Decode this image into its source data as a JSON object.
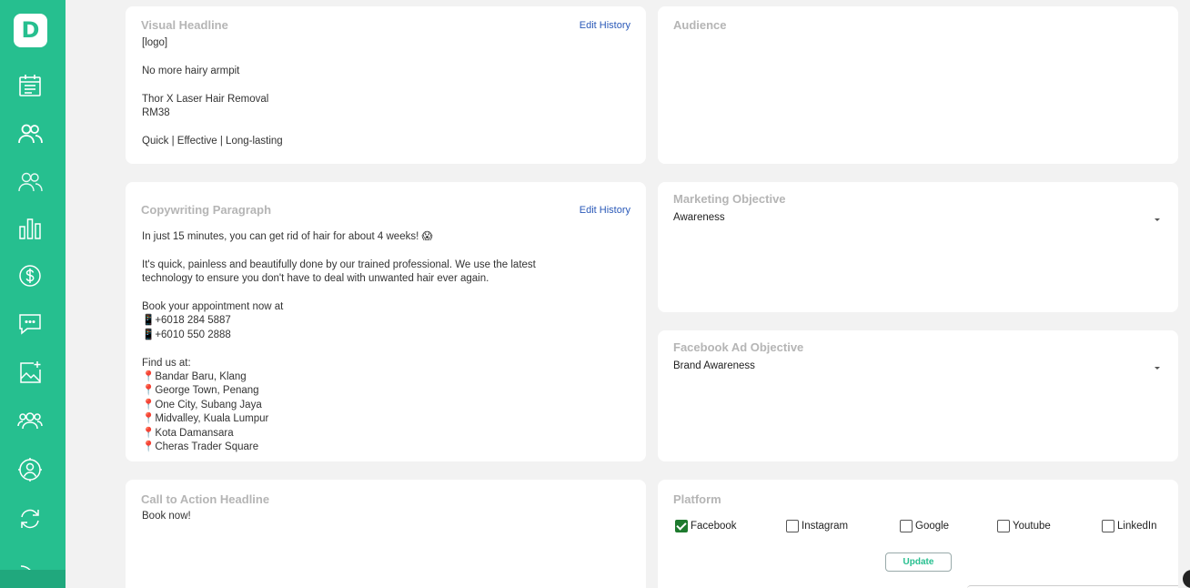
{
  "app": {
    "logo_letter": "D"
  },
  "sidebar": {
    "icons": [
      "calendar-icon",
      "people-icon",
      "users-icon",
      "bar-chart-icon",
      "dollar-icon",
      "chat-icon",
      "image-add-icon",
      "team-icon",
      "user-target-icon",
      "refresh-icon",
      "signal-icon"
    ],
    "accent_color": "#26bf8f"
  },
  "visual_headline": {
    "title": "Visual Headline",
    "edit_history": "Edit History",
    "lines": [
      "[logo]",
      "",
      "No more hairy armpit",
      "",
      "Thor X Laser Hair Removal",
      "RM38",
      "",
      "Quick | Effective | Long-lasting"
    ]
  },
  "audience": {
    "title": "Audience"
  },
  "copywriting": {
    "title": "Copywriting Paragraph",
    "edit_history": "Edit History",
    "lines": [
      "In just 15 minutes, you can get rid of hair for about 4 weeks! 😱",
      "",
      "It's quick, painless and beautifully done by our trained professional. We use the latest",
      "technology to ensure you don't have to deal with unwanted hair ever again.",
      "",
      "Book your appointment now at",
      "📱+6018 284 5887",
      "📱+6010 550 2888",
      "",
      "Find us at:",
      "📍Bandar Baru, Klang",
      "📍George Town, Penang",
      "📍One City, Subang Jaya",
      "📍Midvalley, Kuala Lumpur",
      "📍Kota Damansara",
      "📍Cheras Trader Square"
    ]
  },
  "marketing_objective": {
    "title": "Marketing Objective",
    "value": "Awareness"
  },
  "facebook_ad_objective": {
    "title": "Facebook Ad Objective",
    "value": "Brand Awareness"
  },
  "cta": {
    "title": "Call to Action Headline",
    "text": "Book now!"
  },
  "platform": {
    "title": "Platform",
    "options": [
      {
        "label": "Facebook",
        "checked": true
      },
      {
        "label": "Instagram",
        "checked": false
      },
      {
        "label": "Google",
        "checked": false
      },
      {
        "label": "Youtube",
        "checked": false
      },
      {
        "label": "LinkedIn",
        "checked": false
      }
    ],
    "update_label": "Update"
  }
}
